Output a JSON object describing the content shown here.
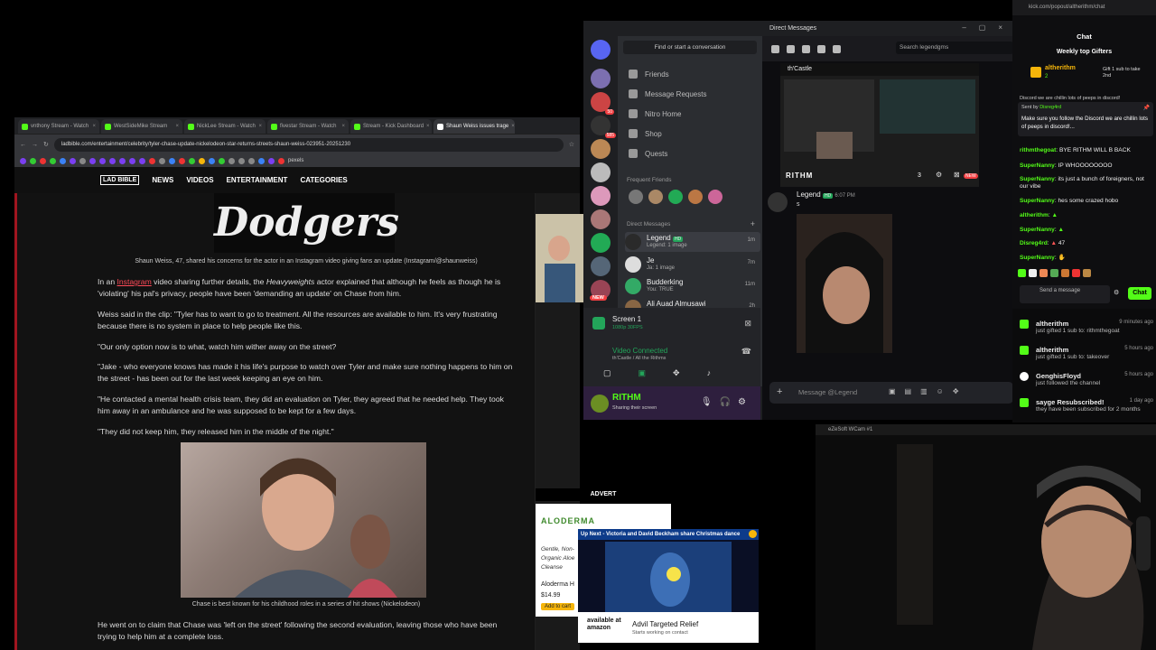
{
  "browser": {
    "tabs": [
      {
        "label": "vnthony Stream - Watch",
        "active": false
      },
      {
        "label": "WestSideMike Stream",
        "active": false
      },
      {
        "label": "NickLee Stream - Watch",
        "active": false
      },
      {
        "label": "fivestar Stream - Watch",
        "active": false
      },
      {
        "label": "Stream - Kick Dashboard",
        "active": false
      },
      {
        "label": "Shaun Weiss issues trage",
        "active": true
      }
    ],
    "url": "ladbible.com/entertainment/celebrity/tyler-chase-update-nickelodeon-star-returns-streets-shaun-weiss-023951-20251230",
    "bookmark_extra": "pexels"
  },
  "site": {
    "logo": "LAD BIBLE",
    "nav": [
      "NEWS",
      "VIDEOS",
      "ENTERTAINMENT",
      "CATEGORIES"
    ]
  },
  "article": {
    "top_image_text": "Dodgers",
    "caption1": "Shaun Weiss, 47, shared his concerns for the actor in an Instagram video giving fans an update (Instagram/@shaunweiss)",
    "p1_pre": "In an ",
    "p1_link": "Instagram",
    "p1_mid": " video sharing further details, the ",
    "p1_em": "Heavyweights",
    "p1_post": " actor explained that although he feels as though he is 'violating' his pal's privacy, people have been 'demanding an update' on Chase from him.",
    "p2": "Weiss said in the clip: \"Tyler has to want to go to treatment. All the resources are available to him. It's very frustrating because there is no system in place to help people like this.",
    "p3": "\"Our only option now is to what, watch him wither away on the street?",
    "p4": "\"Jake - who everyone knows has made it his life's purpose to watch over Tyler and make sure nothing happens to him on the street - has been out for the last week keeping an eye on him.",
    "p5": "\"He contacted a mental health crisis team, they did an evaluation on Tyler, they agreed that he needed help. They took him away in an ambulance and he was supposed to be kept for a few days.",
    "p6": "\"They did not keep him, they released him in the middle of the night.\"",
    "caption2": "Chase is best known for his childhood roles in a series of hit shows (Nickelodeon)",
    "p7": "He went on to claim that Chase was 'left on the street' following the second evaluation, leaving those who have been trying to help him at a complete loss."
  },
  "ads": {
    "advert_label": "ADVERT",
    "brand": "ALODERMA",
    "lines": [
      "Gentle, Non-",
      "Organic Aloe",
      "Cleanse"
    ],
    "product": "Aloderma H",
    "price": "$14.99",
    "cta": "Add to cart",
    "upnext_title": "Up Next - Victoria and David Beckham share Christmas dance",
    "upnext_brand": "available at amazon",
    "upnext_product": "Advil Targeted Relief",
    "upnext_sub": "Starts working on contact"
  },
  "discord": {
    "title": "Direct Messages",
    "search_placeholder": "Find or start a conversation",
    "search_dm_placeholder": "Search legendgms",
    "nav": [
      "Friends",
      "Message Requests",
      "Nitro Home",
      "Shop",
      "Quests"
    ],
    "guild_badges": {
      "g1": "50",
      "g2": "585",
      "new": "NEW"
    },
    "frequent_friends": "Frequent Friends",
    "direct_messages": "Direct Messages",
    "dms": [
      {
        "name": "Legend",
        "tag": "HD",
        "sub": "Legend: 1 image",
        "time": "1m"
      },
      {
        "name": "Je",
        "tag": "",
        "sub": "Ja: 1 image",
        "time": "7m"
      },
      {
        "name": "Budderking",
        "tag": "",
        "sub": "You: TRUE",
        "time": "11m"
      },
      {
        "name": "Ali Auad Almusawi",
        "tag": "",
        "sub": "",
        "time": "2h"
      }
    ],
    "screen_label": "Screen 1",
    "screen_sub": "1080p 30FPS",
    "video_connected": "Video Connected",
    "voice_path": "th'Castle / All the Rithms",
    "user_name": "RITHM",
    "user_status": "Sharing their screen",
    "stream_header": "th'Castle",
    "stream_user": "RITHM",
    "stream_viewers": "3",
    "stream_badge": "NEW",
    "msg_author": "Legend",
    "msg_tag": "HD",
    "msg_time": "6:07 PM",
    "msg_text": "s",
    "message_placeholder": "Message @Legend"
  },
  "kick": {
    "url": "kick.com/popout/altherithm/chat",
    "header": "Chat",
    "gifters_title": "Weekly top Gifters",
    "top_gifter": "altherithm",
    "top_gifter_count": "2",
    "gift_text": "Gift 1 sub to take 2nd",
    "pinned_hint": "Discord we are chillin lots of peeps in discord!",
    "pinned_by": "Sent by",
    "pinned_user": "Disreg4rd",
    "pinned_text": "Make sure you follow the Discord we are chillin lots of peeps in discord!...",
    "messages": [
      {
        "user": "rithmthegoat",
        "text": "BYE RITHM WILL B BACK"
      },
      {
        "user": "SuperNanny",
        "text": "IP WHOOOOOOOO"
      },
      {
        "user": "SuperNanny",
        "text": "its just a bunch of foreigners, not our vibe"
      },
      {
        "user": "SuperNanny",
        "text": "hes some crazed hobo"
      },
      {
        "user": "altherithm",
        "text": ""
      },
      {
        "user": "SuperNanny",
        "text": ""
      },
      {
        "user": "Disreg4rd",
        "text": "47"
      },
      {
        "user": "SuperNanny",
        "text": ""
      }
    ],
    "input_placeholder": "Send a message",
    "chat_button": "Chat",
    "activity": [
      {
        "name": "altherithm",
        "desc": "just gifted 1 sub to: rithmthegoat",
        "time": "9 minutes ago"
      },
      {
        "name": "altherithm",
        "desc": "just gifted 1 sub to: takeover",
        "time": "5 hours ago"
      },
      {
        "name": "GenghisFloyd",
        "desc": "just followed the channel",
        "time": "5 hours ago"
      },
      {
        "name": "sayge Resubscribed!",
        "desc": "they have been subscribed for 2 months",
        "time": "1 day ago"
      }
    ]
  },
  "webcam": {
    "title": "eZeSoft WCam #1"
  }
}
